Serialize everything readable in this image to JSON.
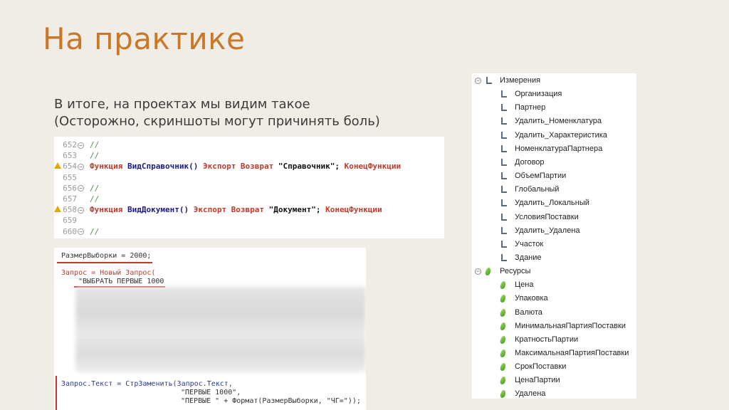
{
  "slide": {
    "title": "На практике",
    "subtitle_line1": "В итоге, на проектах мы видим такое",
    "subtitle_line2": "(Осторожно, скриншоты могут причинять боль)"
  },
  "code1": {
    "lines": [
      {
        "num": "652",
        "fold": true,
        "warn": false,
        "text": "//",
        "kind": "comment"
      },
      {
        "num": "653",
        "fold": false,
        "warn": false,
        "text": "//",
        "kind": "comment"
      },
      {
        "num": "654",
        "fold": true,
        "warn": true,
        "kind": "func",
        "kw": "Функция",
        "name": "ВидСправочник()",
        "mid": "Экспорт Возврат",
        "str": "\"Справочник\";",
        "end": "КонецФункции"
      },
      {
        "num": "655",
        "fold": false,
        "warn": false,
        "text": "",
        "kind": "empty"
      },
      {
        "num": "656",
        "fold": true,
        "warn": false,
        "text": "//",
        "kind": "comment"
      },
      {
        "num": "657",
        "fold": false,
        "warn": false,
        "text": "//",
        "kind": "comment"
      },
      {
        "num": "658",
        "fold": true,
        "warn": true,
        "kind": "func",
        "kw": "Функция",
        "name": "ВидДокумент()",
        "mid": "Экспорт Возврат",
        "str": "\"Документ\";",
        "end": "КонецФункции"
      },
      {
        "num": "659",
        "fold": false,
        "warn": false,
        "text": "",
        "kind": "empty"
      },
      {
        "num": "660",
        "fold": true,
        "warn": false,
        "text": "//",
        "kind": "comment"
      }
    ]
  },
  "code2": {
    "line1": "РазмерВыборки = 2000;",
    "line2": "Запрос = Новый Запрос(",
    "line3": "\"ВЫБРАТЬ ПЕРВЫЕ 1000",
    "line4": "Запрос.Текст = СтрЗаменить(Запрос.Текст,",
    "line5": "\"ПЕРВЫЕ 1000\",",
    "line6": "\"ПЕРВЫЕ \" + Формат(РазмерВыборки, \"ЧГ=\"));"
  },
  "tree": {
    "groups": [
      {
        "label": "Измерения",
        "icon": "dimension-icon",
        "items": [
          "Организация",
          "Партнер",
          "Удалить_Номенклатура",
          "Удалить_Характеристика",
          "НоменклатураПартнера",
          "Договор",
          "ОбъемПартии",
          "Глобальный",
          "Удалить_Локальный",
          "УсловияПоставки",
          "Удалить_Удалена",
          "Участок",
          "Здание"
        ]
      },
      {
        "label": "Ресурсы",
        "icon": "resource-icon",
        "items": [
          "Цена",
          "Упаковка",
          "Валюта",
          "МинимальнаяПартияПоставки",
          "КратностьПартии",
          "МаксимальнаяПартияПоставки",
          "СрокПоставки",
          "ЦенаПартии",
          "Удалена"
        ]
      }
    ]
  },
  "colors": {
    "background": "#f0ede6",
    "title": "#c9782a",
    "keyword": "#c0392b",
    "identifier": "#1a1a8a",
    "warning": "#e0a800",
    "underline": "#c0392b"
  }
}
